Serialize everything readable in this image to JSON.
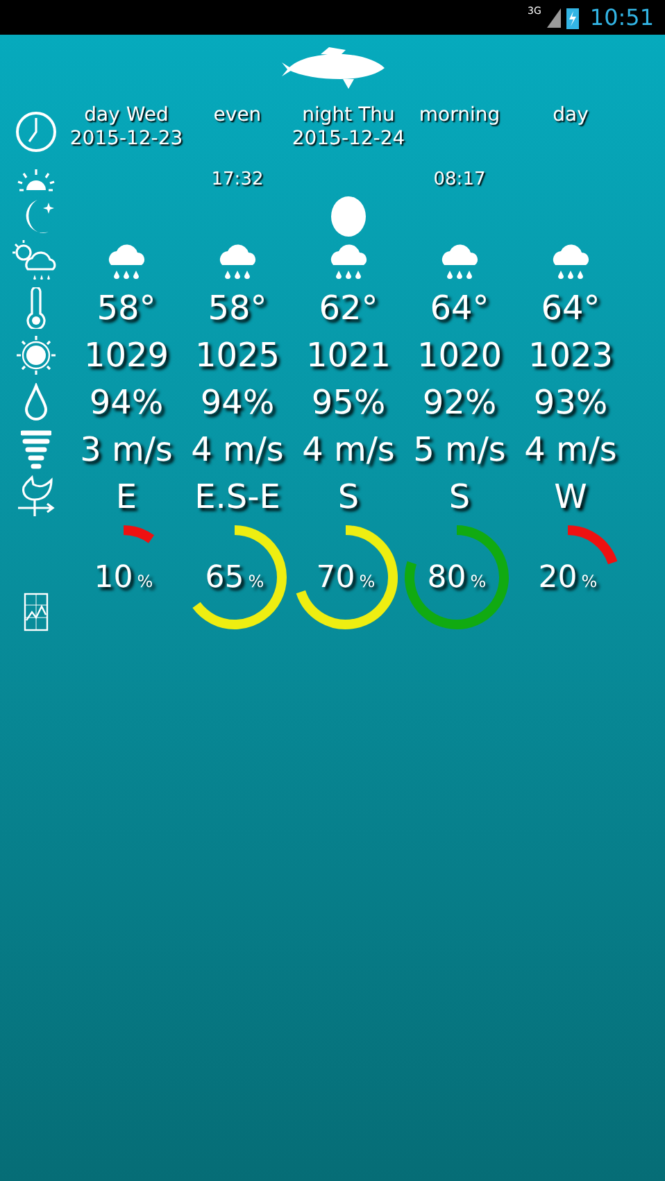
{
  "status_bar": {
    "network": "3G",
    "time": "10:51"
  },
  "columns": [
    {
      "label": "day Wed",
      "date": "2015-12-23",
      "moon": false,
      "kind": "rain",
      "temperature": "58°",
      "pressure": "1029",
      "humidity": "94%",
      "wind": "3 m/s",
      "direction": "E",
      "chance": "10",
      "unit": "%",
      "color": "#ee1111"
    },
    {
      "label": "even",
      "time": "17:32",
      "moon": false,
      "kind": "rain",
      "temperature": "58°",
      "pressure": "1025",
      "humidity": "94%",
      "wind": "4 m/s",
      "direction": "E.S-E",
      "chance": "65",
      "unit": "%",
      "color": "#eeee11"
    },
    {
      "label": "night Thu",
      "date": "2015-12-24",
      "moon": true,
      "kind": "rain",
      "temperature": "62°",
      "pressure": "1021",
      "humidity": "95%",
      "wind": "4 m/s",
      "direction": "S",
      "chance": "70",
      "unit": "%",
      "color": "#eeee11"
    },
    {
      "label": "morning",
      "time": "08:17",
      "moon": false,
      "kind": "rain",
      "temperature": "64°",
      "pressure": "1020",
      "humidity": "92%",
      "wind": "5 m/s",
      "direction": "S",
      "chance": "80",
      "unit": "%",
      "color": "#11aa11"
    },
    {
      "label": "day",
      "moon": false,
      "kind": "rain",
      "temperature": "64°",
      "pressure": "1023",
      "humidity": "93%",
      "wind": "4 m/s",
      "direction": "W",
      "chance": "20",
      "unit": "%",
      "color": "#ee1111"
    }
  ]
}
